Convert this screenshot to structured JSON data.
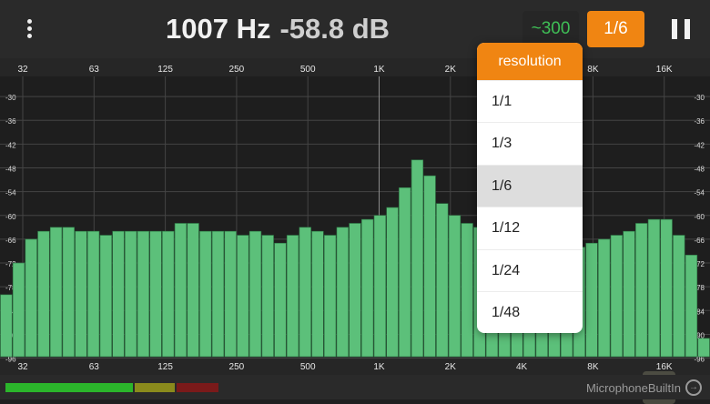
{
  "header": {
    "menu_icon": "vertical-ellipsis-icon",
    "frequency": "1007 Hz",
    "level": "-58.8 dB",
    "averaging_label": "~300",
    "resolution_label": "1/6",
    "pause_icon": "pause-icon"
  },
  "spectrum": {
    "freq_labels": [
      "32",
      "63",
      "125",
      "250",
      "500",
      "1K",
      "2K",
      "4K",
      "8K",
      "16K"
    ],
    "db_labels": [
      "-30",
      "-36",
      "-42",
      "-48",
      "-54",
      "-60",
      "-66",
      "-72",
      "-78",
      "-84",
      "-90",
      "-96"
    ],
    "db_range": [
      -100,
      -27
    ],
    "bar_levels_db": [
      -80,
      -72,
      -66,
      -64,
      -63,
      -63,
      -64,
      -64,
      -65,
      -64,
      -64,
      -64,
      -64,
      -64,
      -62,
      -62,
      -64,
      -64,
      -64,
      -65,
      -64,
      -65,
      -67,
      -65,
      -63,
      -64,
      -65,
      -63,
      -62,
      -61,
      -60,
      -58,
      -53,
      -46,
      -50,
      -57,
      -60,
      -62,
      -63,
      -64,
      -65,
      -66,
      -66,
      -66,
      -67,
      -68,
      -68,
      -67,
      -66,
      -65,
      -64,
      -62,
      -61,
      -61,
      -65,
      -70,
      -91
    ],
    "bar_color": "#5cc07a",
    "grid_color": "#444444"
  },
  "resolution_menu": {
    "title": "resolution",
    "options": [
      "1/1",
      "1/3",
      "1/6",
      "1/12",
      "1/24",
      "1/48"
    ],
    "selected": "1/6"
  },
  "zoom_button_icon": "expand-arrows-icon",
  "footer": {
    "level_meter_colors": [
      "#2bb52b",
      "#8a8a1c",
      "#7a1a1a"
    ],
    "input_device": "MicrophoneBuiltIn",
    "input_icon": "input-source-icon"
  }
}
